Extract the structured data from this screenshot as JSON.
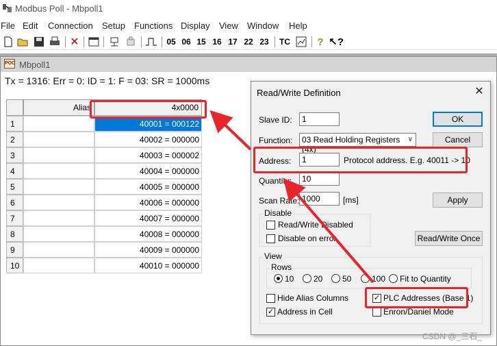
{
  "app": {
    "title": "Modbus Poll - Mbpoll1"
  },
  "menu": {
    "items": [
      "File",
      "Edit",
      "Connection",
      "Setup",
      "Functions",
      "Display",
      "View",
      "Window",
      "Help"
    ]
  },
  "toolbar": {
    "codes": [
      "05",
      "06",
      "15",
      "16",
      "17",
      "22",
      "23"
    ],
    "tc_label": "TC"
  },
  "child": {
    "title": "Mbpoll1",
    "status": "Tx = 1316: Err = 0: ID = 1: F = 03: SR = 1000ms"
  },
  "grid": {
    "alias_header": "Alias",
    "value_header": "4x0000",
    "rows": [
      {
        "num": "1",
        "value": "40001 = 000122"
      },
      {
        "num": "2",
        "value": "40002 = 000000"
      },
      {
        "num": "3",
        "value": "40003 = 000002"
      },
      {
        "num": "4",
        "value": "40004 = 000000"
      },
      {
        "num": "5",
        "value": "40005 = 000000"
      },
      {
        "num": "6",
        "value": "40006 = 000000"
      },
      {
        "num": "7",
        "value": "40007 = 000000"
      },
      {
        "num": "8",
        "value": "40008 = 000000"
      },
      {
        "num": "9",
        "value": "40009 = 000000"
      },
      {
        "num": "10",
        "value": "40010 = 000000"
      }
    ]
  },
  "dialog": {
    "title": "Read/Write Definition",
    "slave_id_label": "Slave ID:",
    "slave_id_value": "1",
    "function_label": "Function:",
    "function_value": "03 Read Holding Registers (4x)",
    "address_label": "Address:",
    "address_value": "1",
    "address_hint": "Protocol address. E.g. 40011 -> 10",
    "quantity_label": "Quantity:",
    "quantity_value": "10",
    "scan_rate_label": "Scan Rate:",
    "scan_rate_value": "1000",
    "scan_rate_unit": "[ms]",
    "ok_label": "OK",
    "cancel_label": "Cancel",
    "apply_label": "Apply",
    "read_write_once_label": "Read/Write Once",
    "disable_group": "Disable",
    "read_write_disabled": "Read/Write Disabled",
    "disable_on_error": "Disable on error",
    "view_group": "View",
    "rows_group": "Rows",
    "rows_options": [
      "10",
      "20",
      "50",
      "100",
      "Fit to Quantity"
    ],
    "rows_selected": "10",
    "hide_alias_columns": "Hide Alias Columns",
    "address_in_cell": "Address in Cell",
    "plc_addresses": "PLC Addresses (Base 1)",
    "enron_daniel_mode": "Enron/Daniel Mode"
  },
  "colors": {
    "highlight": "#e8252b",
    "selection": "#0078d7"
  },
  "watermark": "CSDN @_三石_"
}
